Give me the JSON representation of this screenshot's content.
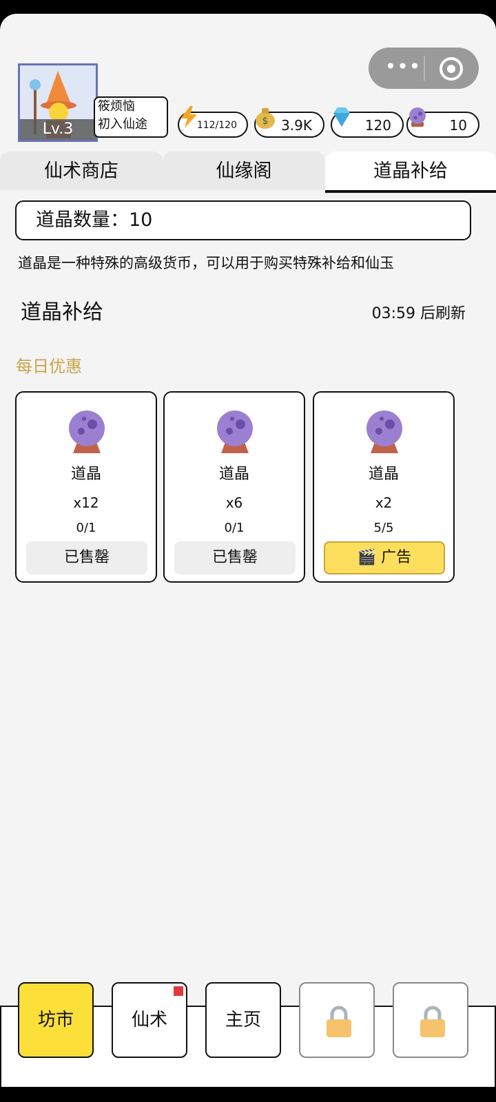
{
  "player": {
    "level": "Lv.3",
    "name": "筱烦恼",
    "title": "初入仙途"
  },
  "resources": {
    "energy": "112/120",
    "coins": "3.9K",
    "diamonds": "120",
    "daojing": "10"
  },
  "tabs": [
    "仙术商店",
    "仙缘阁",
    "道晶补给"
  ],
  "active_tab": "道晶补给",
  "daojing_count_label": "道晶数量：10",
  "description": "道晶是一种特殊的高级货币，可以用于购买特殊补给和仙玉",
  "supply": {
    "title": "道晶补给",
    "refresh": "03:59 后刷新",
    "section": "每日优惠",
    "items": [
      {
        "name": "道晶",
        "qty": "x12",
        "limit": "0/1",
        "action": "已售罄"
      },
      {
        "name": "道晶",
        "qty": "x6",
        "limit": "0/1",
        "action": "已售罄"
      },
      {
        "name": "道晶",
        "qty": "x2",
        "limit": "5/5",
        "action": "🎬 广告"
      }
    ]
  },
  "bottom_nav": [
    {
      "label": "坊市",
      "active": true
    },
    {
      "label": "仙术"
    },
    {
      "label": "主页"
    },
    {
      "label": "",
      "locked": true
    },
    {
      "label": "",
      "locked": true
    }
  ],
  "colors": {
    "accent_yellow": "#fddf3a",
    "daily_gold": "#c9a448",
    "orb_purple": "#9b7fd0"
  }
}
